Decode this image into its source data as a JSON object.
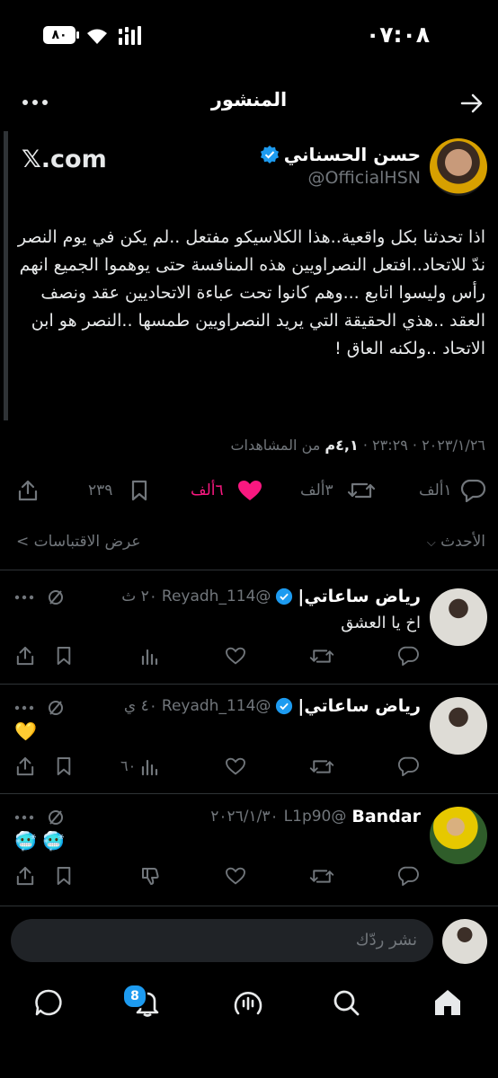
{
  "status_bar": {
    "time": "٠٧:٠٨",
    "battery": "٨٠"
  },
  "header": {
    "title": "المنشور"
  },
  "post": {
    "author_name": "حسن الحسناني",
    "handle": "@OfficialHSN",
    "source_link": "𝕏.com",
    "body": "اذا تحدثنا بكل واقعية..هذا الكلاسيكو مفتعل ..لم يكن في يوم النصر ندّ للاتحاد..افتعل النصراويين هذه المنافسة حتى يوهموا الجميع انهم رأس وليسوا اتابع ...وهم كانوا تحت عباءة الاتحاديين عقد ونصف العقد ..هذي الحقيقة التي يريد النصراويين طمسها ..النصر هو ابن الاتحاد ..ولكنه العاق !",
    "meta_prefix": "٢٠٢٣/١/٢٦ · ٢٣:٢٩ · ",
    "meta_views": "٤,١م",
    "meta_suffix": " من المشاهدات",
    "replies": "١ألف",
    "reposts": "٣ألف",
    "likes": "٦ألف",
    "bookmarks": "٢٣٩"
  },
  "sort": {
    "label": "الأحدث",
    "quotes_label": "عرض الاقتباسات"
  },
  "replies": [
    {
      "name": "رياض ساعاتي|",
      "handle": "@Reyadh_114",
      "time": "٢٠ ث",
      "text": "اخ يا العشق",
      "views": ""
    },
    {
      "name": "رياض ساعاتي|",
      "handle": "@Reyadh_114",
      "time": "٤٠ ي",
      "text": "💛",
      "views": "٦٠"
    },
    {
      "name": "Bandar",
      "handle": "@L1p90",
      "time": "٢٠٢٦/١/٣٠",
      "text": "🥶 🥶",
      "views": ""
    }
  ],
  "composer": {
    "placeholder": "نشر ردّك"
  },
  "bottom_nav": {
    "notifications_badge": "8"
  },
  "colors": {
    "like": "#f91880",
    "verified": "#1d9bf0",
    "badge": "#1d9bf0"
  }
}
